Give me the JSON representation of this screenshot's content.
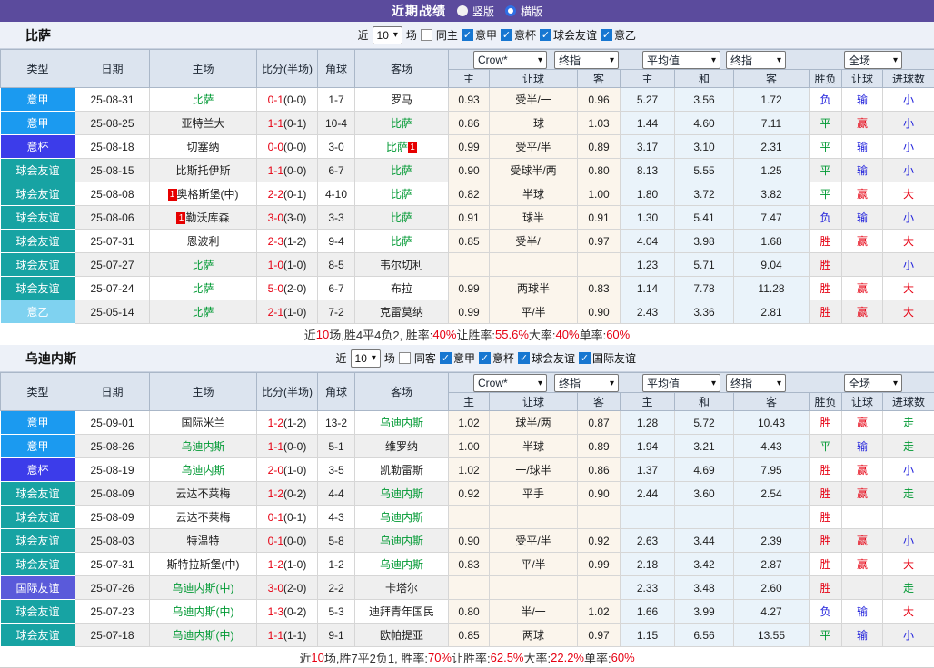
{
  "topbar": {
    "title": "近期战绩",
    "radios": [
      {
        "label": "竖版",
        "selected": false
      },
      {
        "label": "横版",
        "selected": true
      }
    ]
  },
  "colors": {
    "topbar": "#5b4b9d",
    "league": {
      "意甲": "#1b9af0",
      "意杯": "#3c3cea",
      "球会友谊": "#17a3a3",
      "意乙": "#7fd2f0",
      "国际友谊": "#5a5ada"
    },
    "team_green": "#009933",
    "score_red": "#e60012",
    "result": {
      "胜": "#e60012",
      "平": "#009933",
      "负": "#2323dc",
      "赢": "#e60012",
      "输": "#2323dc",
      "大": "#e60012",
      "小": "#2323dc",
      "走": "#009933"
    }
  },
  "table": {
    "main_columns": [
      "类型",
      "日期",
      "主场",
      "比分(半场)",
      "角球",
      "客场"
    ],
    "sub_columns": [
      "主",
      "让球",
      "客",
      "主",
      "和",
      "客",
      "胜负",
      "让球",
      "进球数"
    ],
    "dropdowns": [
      "Crow*",
      "终指",
      "平均值",
      "终指",
      "全场"
    ]
  },
  "sections": [
    {
      "team": "比萨",
      "filter": {
        "near": "近",
        "count": "10",
        "games": "场",
        "same": "同主",
        "same_checked": false,
        "leagues": [
          {
            "label": "意甲",
            "checked": true
          },
          {
            "label": "意杯",
            "checked": true
          },
          {
            "label": "球会友谊",
            "checked": true
          },
          {
            "label": "意乙",
            "checked": true
          }
        ]
      },
      "rows": [
        {
          "type": "意甲",
          "date": "25-08-31",
          "home": "比萨",
          "home_green": true,
          "home_card": "",
          "score": "0-1",
          "half": "(0-0)",
          "corner": "1-7",
          "away": "罗马",
          "away_green": false,
          "away_card": "",
          "crow_home": "0.93",
          "handicap": "受半/一",
          "crow_away": "0.96",
          "avg_home": "5.27",
          "avg_draw": "3.56",
          "avg_away": "1.72",
          "res_wdl": "负",
          "res_handicap": "输",
          "res_goal": "小"
        },
        {
          "type": "意甲",
          "date": "25-08-25",
          "home": "亚特兰大",
          "home_green": false,
          "home_card": "",
          "score": "1-1",
          "half": "(0-1)",
          "corner": "10-4",
          "away": "比萨",
          "away_green": true,
          "away_card": "",
          "crow_home": "0.86",
          "handicap": "一球",
          "crow_away": "1.03",
          "avg_home": "1.44",
          "avg_draw": "4.60",
          "avg_away": "7.11",
          "res_wdl": "平",
          "res_handicap": "赢",
          "res_goal": "小"
        },
        {
          "type": "意杯",
          "date": "25-08-18",
          "home": "切塞纳",
          "home_green": false,
          "home_card": "",
          "score": "0-0",
          "half": "(0-0)",
          "corner": "3-0",
          "away": "比萨",
          "away_green": true,
          "away_card": "1",
          "crow_home": "0.99",
          "handicap": "受平/半",
          "crow_away": "0.89",
          "avg_home": "3.17",
          "avg_draw": "3.10",
          "avg_away": "2.31",
          "res_wdl": "平",
          "res_handicap": "输",
          "res_goal": "小"
        },
        {
          "type": "球会友谊",
          "date": "25-08-15",
          "home": "比斯托伊斯",
          "home_green": false,
          "home_card": "",
          "score": "1-1",
          "half": "(0-0)",
          "corner": "6-7",
          "away": "比萨",
          "away_green": true,
          "away_card": "",
          "crow_home": "0.90",
          "handicap": "受球半/两",
          "crow_away": "0.80",
          "avg_home": "8.13",
          "avg_draw": "5.55",
          "avg_away": "1.25",
          "res_wdl": "平",
          "res_handicap": "输",
          "res_goal": "小"
        },
        {
          "type": "球会友谊",
          "date": "25-08-08",
          "home": "奥格斯堡(中)",
          "home_green": false,
          "home_card": "1",
          "score": "2-2",
          "half": "(0-1)",
          "corner": "4-10",
          "away": "比萨",
          "away_green": true,
          "away_card": "",
          "crow_home": "0.82",
          "handicap": "半球",
          "crow_away": "1.00",
          "avg_home": "1.80",
          "avg_draw": "3.72",
          "avg_away": "3.82",
          "res_wdl": "平",
          "res_handicap": "赢",
          "res_goal": "大"
        },
        {
          "type": "球会友谊",
          "date": "25-08-06",
          "home": "勒沃库森",
          "home_green": false,
          "home_card": "1",
          "score": "3-0",
          "half": "(3-0)",
          "corner": "3-3",
          "away": "比萨",
          "away_green": true,
          "away_card": "",
          "crow_home": "0.91",
          "handicap": "球半",
          "crow_away": "0.91",
          "avg_home": "1.30",
          "avg_draw": "5.41",
          "avg_away": "7.47",
          "res_wdl": "负",
          "res_handicap": "输",
          "res_goal": "小"
        },
        {
          "type": "球会友谊",
          "date": "25-07-31",
          "home": "恩波利",
          "home_green": false,
          "home_card": "",
          "score": "2-3",
          "half": "(1-2)",
          "corner": "9-4",
          "away": "比萨",
          "away_green": true,
          "away_card": "",
          "crow_home": "0.85",
          "handicap": "受半/一",
          "crow_away": "0.97",
          "avg_home": "4.04",
          "avg_draw": "3.98",
          "avg_away": "1.68",
          "res_wdl": "胜",
          "res_handicap": "赢",
          "res_goal": "大"
        },
        {
          "type": "球会友谊",
          "date": "25-07-27",
          "home": "比萨",
          "home_green": true,
          "home_card": "",
          "score": "1-0",
          "half": "(1-0)",
          "corner": "8-5",
          "away": "韦尔切利",
          "away_green": false,
          "away_card": "",
          "crow_home": "",
          "handicap": "",
          "crow_away": "",
          "avg_home": "1.23",
          "avg_draw": "5.71",
          "avg_away": "9.04",
          "res_wdl": "胜",
          "res_handicap": "",
          "res_goal": "小"
        },
        {
          "type": "球会友谊",
          "date": "25-07-24",
          "home": "比萨",
          "home_green": true,
          "home_card": "",
          "score": "5-0",
          "half": "(2-0)",
          "corner": "6-7",
          "away": "布拉",
          "away_green": false,
          "away_card": "",
          "crow_home": "0.99",
          "handicap": "两球半",
          "crow_away": "0.83",
          "avg_home": "1.14",
          "avg_draw": "7.78",
          "avg_away": "11.28",
          "res_wdl": "胜",
          "res_handicap": "赢",
          "res_goal": "大"
        },
        {
          "type": "意乙",
          "date": "25-05-14",
          "home": "比萨",
          "home_green": true,
          "home_card": "",
          "score": "2-1",
          "half": "(1-0)",
          "corner": "7-2",
          "away": "克雷莫纳",
          "away_green": false,
          "away_card": "",
          "crow_home": "0.99",
          "handicap": "平/半",
          "crow_away": "0.90",
          "avg_home": "2.43",
          "avg_draw": "3.36",
          "avg_away": "2.81",
          "res_wdl": "胜",
          "res_handicap": "赢",
          "res_goal": "大"
        }
      ],
      "summary": [
        [
          "近",
          0
        ],
        [
          "10",
          1
        ],
        [
          "场,胜4平4负2, 胜率:",
          0
        ],
        [
          "40%",
          1
        ],
        [
          " 让胜率:",
          0
        ],
        [
          "55.6%",
          1
        ],
        [
          " 大率:",
          0
        ],
        [
          "40%",
          1
        ],
        [
          " 单率:",
          0
        ],
        [
          "60%",
          1
        ]
      ]
    },
    {
      "team": "乌迪内斯",
      "filter": {
        "near": "近",
        "count": "10",
        "games": "场",
        "same": "同客",
        "same_checked": false,
        "leagues": [
          {
            "label": "意甲",
            "checked": true
          },
          {
            "label": "意杯",
            "checked": true
          },
          {
            "label": "球会友谊",
            "checked": true
          },
          {
            "label": "国际友谊",
            "checked": true
          }
        ]
      },
      "rows": [
        {
          "type": "意甲",
          "date": "25-09-01",
          "home": "国际米兰",
          "home_green": false,
          "home_card": "",
          "score": "1-2",
          "half": "(1-2)",
          "corner": "13-2",
          "away": "乌迪内斯",
          "away_green": true,
          "away_card": "",
          "crow_home": "1.02",
          "handicap": "球半/两",
          "crow_away": "0.87",
          "avg_home": "1.28",
          "avg_draw": "5.72",
          "avg_away": "10.43",
          "res_wdl": "胜",
          "res_handicap": "赢",
          "res_goal": "走"
        },
        {
          "type": "意甲",
          "date": "25-08-26",
          "home": "乌迪内斯",
          "home_green": true,
          "home_card": "",
          "score": "1-1",
          "half": "(0-0)",
          "corner": "5-1",
          "away": "维罗纳",
          "away_green": false,
          "away_card": "",
          "crow_home": "1.00",
          "handicap": "半球",
          "crow_away": "0.89",
          "avg_home": "1.94",
          "avg_draw": "3.21",
          "avg_away": "4.43",
          "res_wdl": "平",
          "res_handicap": "输",
          "res_goal": "走"
        },
        {
          "type": "意杯",
          "date": "25-08-19",
          "home": "乌迪内斯",
          "home_green": true,
          "home_card": "",
          "score": "2-0",
          "half": "(1-0)",
          "corner": "3-5",
          "away": "凯勒雷斯",
          "away_green": false,
          "away_card": "",
          "crow_home": "1.02",
          "handicap": "一/球半",
          "crow_away": "0.86",
          "avg_home": "1.37",
          "avg_draw": "4.69",
          "avg_away": "7.95",
          "res_wdl": "胜",
          "res_handicap": "赢",
          "res_goal": "小"
        },
        {
          "type": "球会友谊",
          "date": "25-08-09",
          "home": "云达不莱梅",
          "home_green": false,
          "home_card": "",
          "score": "1-2",
          "half": "(0-2)",
          "corner": "4-4",
          "away": "乌迪内斯",
          "away_green": true,
          "away_card": "",
          "crow_home": "0.92",
          "handicap": "平手",
          "crow_away": "0.90",
          "avg_home": "2.44",
          "avg_draw": "3.60",
          "avg_away": "2.54",
          "res_wdl": "胜",
          "res_handicap": "赢",
          "res_goal": "走"
        },
        {
          "type": "球会友谊",
          "date": "25-08-09",
          "home": "云达不莱梅",
          "home_green": false,
          "home_card": "",
          "score": "0-1",
          "half": "(0-1)",
          "corner": "4-3",
          "away": "乌迪内斯",
          "away_green": true,
          "away_card": "",
          "crow_home": "",
          "handicap": "",
          "crow_away": "",
          "avg_home": "",
          "avg_draw": "",
          "avg_away": "",
          "res_wdl": "胜",
          "res_handicap": "",
          "res_goal": ""
        },
        {
          "type": "球会友谊",
          "date": "25-08-03",
          "home": "特温特",
          "home_green": false,
          "home_card": "",
          "score": "0-1",
          "half": "(0-0)",
          "corner": "5-8",
          "away": "乌迪内斯",
          "away_green": true,
          "away_card": "",
          "crow_home": "0.90",
          "handicap": "受平/半",
          "crow_away": "0.92",
          "avg_home": "2.63",
          "avg_draw": "3.44",
          "avg_away": "2.39",
          "res_wdl": "胜",
          "res_handicap": "赢",
          "res_goal": "小"
        },
        {
          "type": "球会友谊",
          "date": "25-07-31",
          "home": "斯特拉斯堡(中)",
          "home_green": false,
          "home_card": "",
          "score": "1-2",
          "half": "(1-0)",
          "corner": "1-2",
          "away": "乌迪内斯",
          "away_green": true,
          "away_card": "",
          "crow_home": "0.83",
          "handicap": "平/半",
          "crow_away": "0.99",
          "avg_home": "2.18",
          "avg_draw": "3.42",
          "avg_away": "2.87",
          "res_wdl": "胜",
          "res_handicap": "赢",
          "res_goal": "大"
        },
        {
          "type": "国际友谊",
          "date": "25-07-26",
          "home": "乌迪内斯(中)",
          "home_green": true,
          "home_card": "",
          "score": "3-0",
          "half": "(2-0)",
          "corner": "2-2",
          "away": "卡塔尔",
          "away_green": false,
          "away_card": "",
          "crow_home": "",
          "handicap": "",
          "crow_away": "",
          "avg_home": "2.33",
          "avg_draw": "3.48",
          "avg_away": "2.60",
          "res_wdl": "胜",
          "res_handicap": "",
          "res_goal": "走"
        },
        {
          "type": "球会友谊",
          "date": "25-07-23",
          "home": "乌迪内斯(中)",
          "home_green": true,
          "home_card": "",
          "score": "1-3",
          "half": "(0-2)",
          "corner": "5-3",
          "away": "迪拜青年国民",
          "away_green": false,
          "away_card": "",
          "crow_home": "0.80",
          "handicap": "半/一",
          "crow_away": "1.02",
          "avg_home": "1.66",
          "avg_draw": "3.99",
          "avg_away": "4.27",
          "res_wdl": "负",
          "res_handicap": "输",
          "res_goal": "大"
        },
        {
          "type": "球会友谊",
          "date": "25-07-18",
          "home": "乌迪内斯(中)",
          "home_green": true,
          "home_card": "",
          "score": "1-1",
          "half": "(1-1)",
          "corner": "9-1",
          "away": "欧帕提亚",
          "away_green": false,
          "away_card": "",
          "crow_home": "0.85",
          "handicap": "两球",
          "crow_away": "0.97",
          "avg_home": "1.15",
          "avg_draw": "6.56",
          "avg_away": "13.55",
          "res_wdl": "平",
          "res_handicap": "输",
          "res_goal": "小"
        }
      ],
      "summary": [
        [
          "近",
          0
        ],
        [
          "10",
          1
        ],
        [
          "场,胜7平2负1, 胜率:",
          0
        ],
        [
          "70%",
          1
        ],
        [
          " 让胜率:",
          0
        ],
        [
          "62.5%",
          1
        ],
        [
          " 大率:",
          0
        ],
        [
          "22.2%",
          1
        ],
        [
          " 单率:",
          0
        ],
        [
          "60%",
          1
        ]
      ]
    }
  ]
}
